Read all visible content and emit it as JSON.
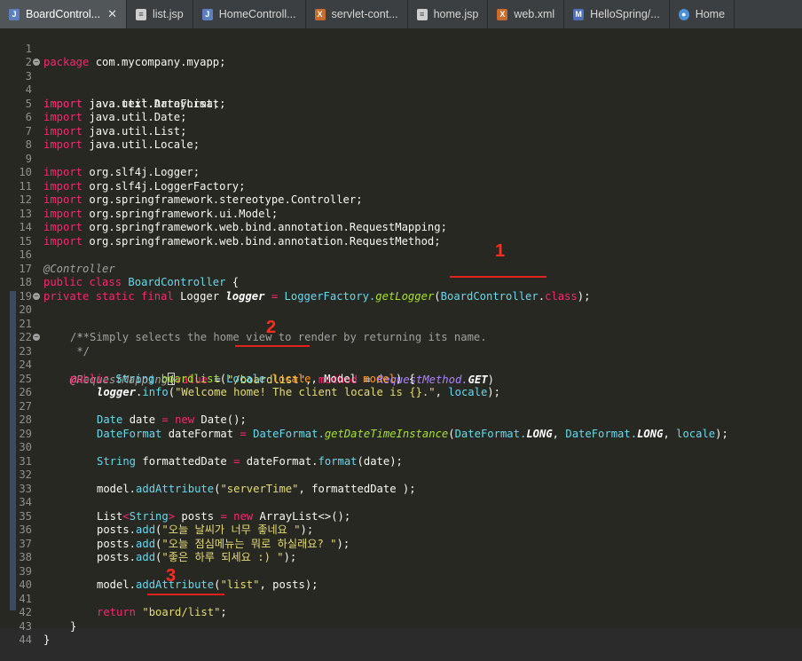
{
  "tabs": [
    {
      "label": "BoardControl...",
      "icon": "java-file-icon",
      "active": true,
      "close": "✕"
    },
    {
      "label": "list.jsp",
      "icon": "jsp-file-icon"
    },
    {
      "label": "HomeControll...",
      "icon": "java-file-icon"
    },
    {
      "label": "servlet-cont...",
      "icon": "xml-file-icon"
    },
    {
      "label": "home.jsp",
      "icon": "jsp-file-icon"
    },
    {
      "label": "web.xml",
      "icon": "xml-file-icon"
    },
    {
      "label": "HelloSpring/...",
      "icon": "maven-file-icon"
    },
    {
      "label": "Home",
      "icon": "globe-icon"
    }
  ],
  "gutter": {
    "line_numbers": [
      "1",
      "2",
      "3",
      "4",
      "5",
      "6",
      "7",
      "8",
      "9",
      "10",
      "11",
      "12",
      "13",
      "14",
      "15",
      "16",
      "17",
      "18",
      "19",
      "20",
      "21",
      "22",
      "23",
      "24",
      "25",
      "26",
      "27",
      "28",
      "29",
      "30",
      "31",
      "32",
      "33",
      "34",
      "35",
      "36",
      "37",
      "38",
      "39",
      "40",
      "41",
      "42",
      "43",
      "44"
    ],
    "fold_marker": "−"
  },
  "code": {
    "l1": "package com.mycompany.myapp;",
    "kw_import": "import",
    "l3": " java.text.DateFormat;",
    "l4": " java.util.ArrayList;",
    "l5": " java.util.Date;",
    "l6": " java.util.List;",
    "l7": " java.util.Locale;",
    "l9": " org.slf4j.Logger;",
    "l10": " org.slf4j.LoggerFactory;",
    "l11": " org.springframework.stereotype.Controller;",
    "l12": " org.springframework.ui.Model;",
    "l13": " org.springframework.web.bind.annotation.RequestMapping;",
    "l14": " org.springframework.web.bind.annotation.RequestMethod;",
    "l16": "@Controller",
    "l17_kw": "public class",
    "l17_cls": " BoardController",
    "l17_end": " {",
    "l18_kw": "private static final",
    "l18_ty": " Logger",
    "l18_var": " logger",
    "l18_eq": " = ",
    "l18_fac": "LoggerFactory.",
    "l18_fn": "getLogger",
    "l18_p1": "(",
    "l18_cls": "BoardController",
    "l18_dot": ".",
    "l18_class": "class",
    "l18_end": ");",
    "l20": "/**",
    "l21": " * Simply selects the home view to render by returning its name.",
    "l22": " */",
    "l23_an": "@RequestMapping",
    "l23_p": "(",
    "l23_val": "value",
    "l23_eq": " = ",
    "l23_str": "\"/boardlist\"",
    "l23_comma": ", ",
    "l23_method": "method",
    "l23_eq2": " = ",
    "l23_rm": "RequestMethod.",
    "l23_get": "GET",
    "l23_end": ")",
    "l24_kw": "public",
    "l24_ty": " String",
    "l24_fn": " boardlist",
    "l24_p": "(",
    "l24_loc": "Locale",
    "l24_a1": " locale",
    "l24_c": ", ",
    "l24_model": "Model",
    "l24_a2": " model",
    "l24_end": ") {",
    "l25_var": "logger",
    "l25_dot": ".",
    "l25_fn": "info",
    "l25_p": "(",
    "l25_str": "\"Welcome home! The client locale is {}.\"",
    "l25_c": ", ",
    "l25_loc": "locale",
    "l25_end": ");",
    "l27_ty": "Date",
    "l27_var": " date",
    "l27_eq": " = ",
    "l27_new": "new",
    "l27_fn": " Date",
    "l27_end": "();",
    "l28_ty": "DateFormat",
    "l28_var": " dateFormat",
    "l28_eq": " = ",
    "l28_df": "DateFormat.",
    "l28_fn": "getDateTimeInstance",
    "l28_p": "(",
    "l28_df2": "DateFormat.",
    "l28_long": "LONG",
    "l28_c": ", ",
    "l28_df3": "DateFormat.",
    "l28_long2": "LONG",
    "l28_c2": ", ",
    "l28_loc": "locale",
    "l28_end": ");",
    "l30_ty": "String",
    "l30_var": " formattedDate",
    "l30_eq": " = ",
    "l30_obj": "dateFormat.",
    "l30_fn": "format",
    "l30_end": "(date);",
    "l32_obj": "model.",
    "l32_fn": "addAttribute",
    "l32_p": "(",
    "l32_str": "\"serverTime\"",
    "l32_rest": ", formattedDate );",
    "l34_ty": "List",
    "l34_lt": "<",
    "l34_str": "String",
    "l34_gt": ">",
    "l34_var": " posts",
    "l34_eq": " = ",
    "l34_new": "new",
    "l34_fn": " ArrayList",
    "l34_end": "<>();",
    "l35_obj": "posts.",
    "l35_fn": "add",
    "l35_p": "(",
    "l35_str": "\"오늘 날씨가 너무 좋네요 \"",
    "l35_end": ");",
    "l36_str": "\"오늘 점심메뉴는 뭐로 하실래요? \"",
    "l37_str": "\"좋은 하루 되세요 :) \"",
    "l39_str": "\"list\"",
    "l39_rest": ", posts);",
    "l41_kw": "return",
    "l41_str": " \"board/list\"",
    "l41_end": ";",
    "l42": "}",
    "l43": "}"
  },
  "markers": {
    "m1": "1",
    "m2": "2",
    "m3": "3"
  }
}
